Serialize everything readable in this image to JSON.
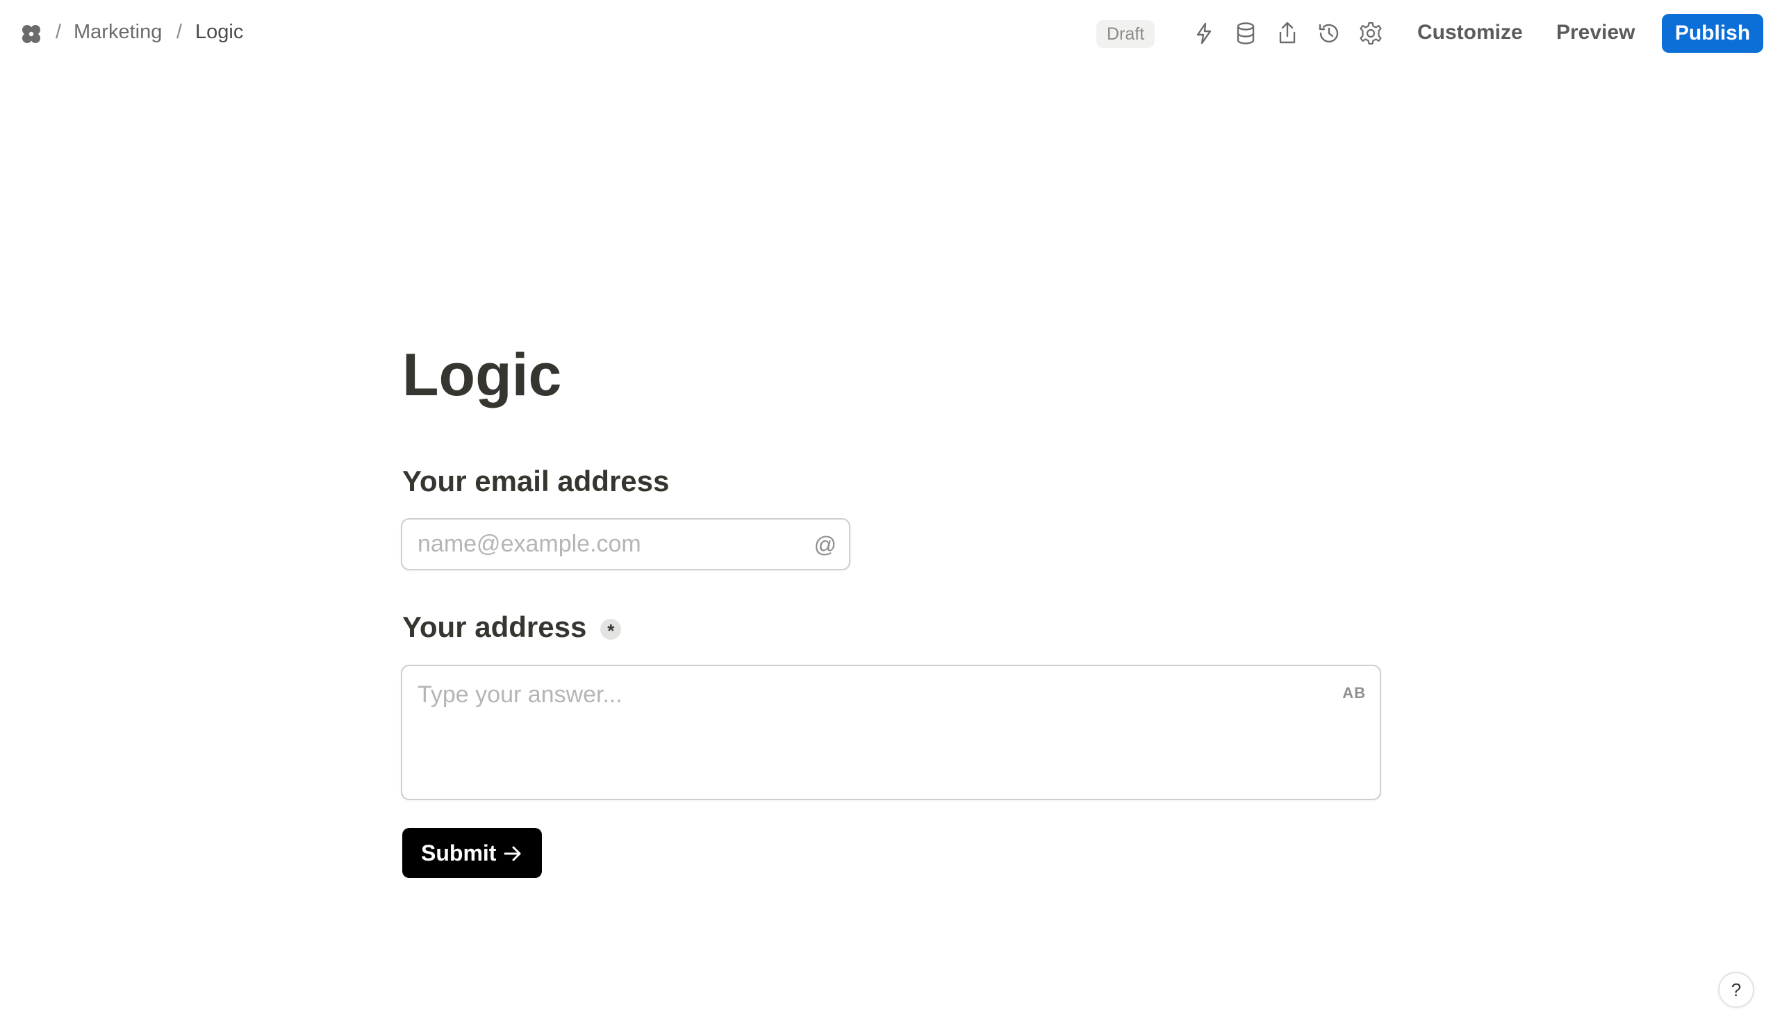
{
  "breadcrumb": {
    "separator": "/",
    "items": [
      "Marketing",
      "Logic"
    ]
  },
  "header": {
    "status_badge": "Draft",
    "icons": [
      "lightning-icon",
      "database-icon",
      "share-icon",
      "history-icon",
      "settings-icon"
    ],
    "customize_label": "Customize",
    "preview_label": "Preview",
    "publish_label": "Publish"
  },
  "form": {
    "title": "Logic",
    "questions": [
      {
        "label": "Your email address",
        "placeholder": "name@example.com",
        "type_icon": "@",
        "required": false
      },
      {
        "label": "Your address",
        "placeholder": "Type your answer...",
        "type_icon": "AB",
        "required": true,
        "required_mark": "*"
      }
    ],
    "submit_label": "Submit"
  },
  "help": {
    "label": "?"
  },
  "colors": {
    "publish_button": "#0b6fd7",
    "submit_button": "#000000",
    "badge_background": "#f1f1ef",
    "text_primary": "#37352f"
  }
}
